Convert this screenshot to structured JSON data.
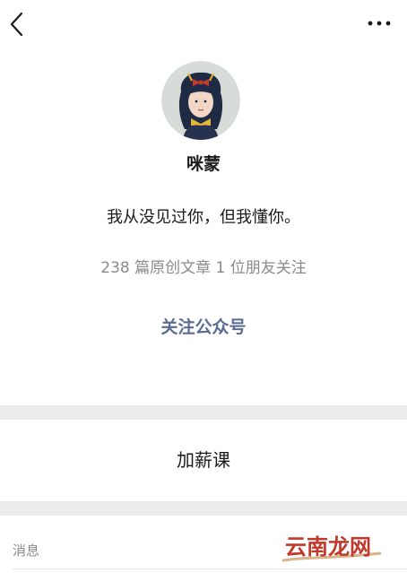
{
  "header": {
    "back_icon": "chevron-left-icon",
    "more_icon": "more-dots-icon"
  },
  "profile": {
    "avatar_icon": "cartoon-girl-avatar",
    "name": "咪蒙",
    "signature": "我从没见过你，但我懂你。",
    "stats": "238 篇原创文章  1 位朋友关注",
    "follow_label": "关注公众号"
  },
  "menu": {
    "items": [
      {
        "label": "加薪课"
      }
    ]
  },
  "footer": {
    "messages_label": "消息",
    "watermark_text": "云南龙网"
  },
  "colors": {
    "follow_accent": "#5b6b93",
    "muted_text": "#8a8a8a",
    "section_band": "#ededed",
    "watermark": "#c0392b"
  }
}
